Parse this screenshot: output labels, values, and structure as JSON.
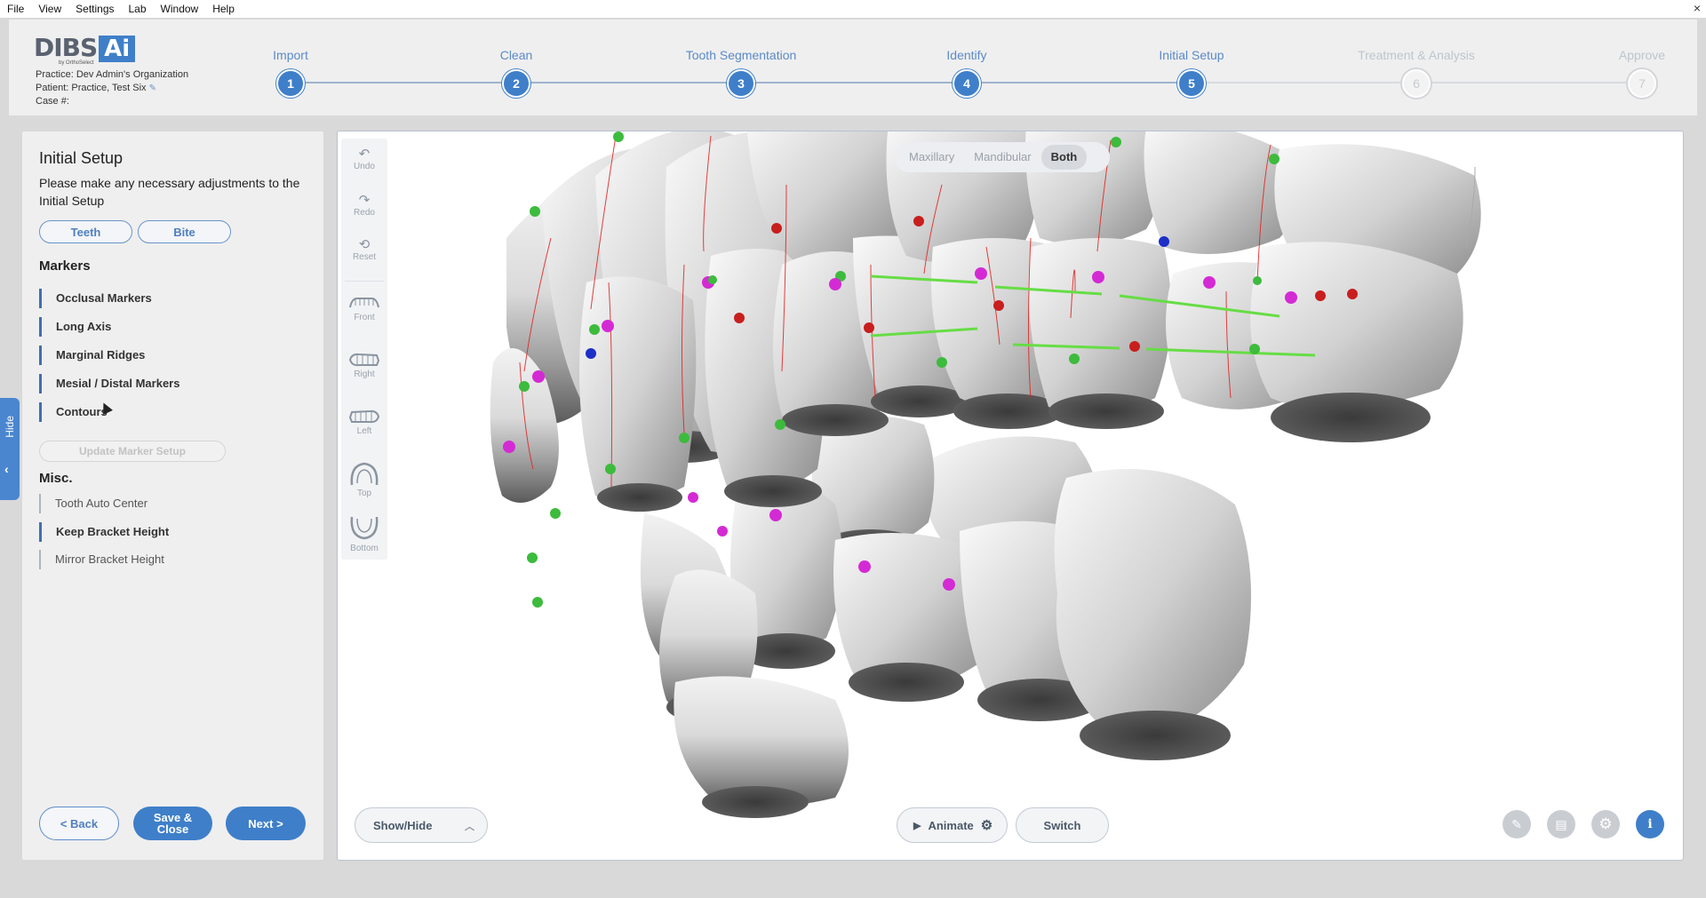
{
  "menu": [
    "File",
    "View",
    "Settings",
    "Lab",
    "Window",
    "Help"
  ],
  "window_close": "×",
  "logo": {
    "main": "DIBS",
    "accent": "Ai",
    "sub": "by OrthoSelect"
  },
  "practice_info": {
    "practice": "Practice: Dev Admin's Organization",
    "patient": "Patient: Practice, Test Six",
    "case": "Case #:"
  },
  "steps": [
    {
      "label": "Import",
      "number": "1",
      "state": "done"
    },
    {
      "label": "Clean",
      "number": "2",
      "state": "done"
    },
    {
      "label": "Tooth Segmentation",
      "number": "3",
      "state": "done"
    },
    {
      "label": "Identify",
      "number": "4",
      "state": "done"
    },
    {
      "label": "Initial Setup",
      "number": "5",
      "state": "current"
    },
    {
      "label": "Treatment & Analysis",
      "number": "6",
      "state": "inactive"
    },
    {
      "label": "Approve",
      "number": "7",
      "state": "inactive"
    }
  ],
  "hide_tab": {
    "label": "Hide",
    "chevron": "‹"
  },
  "left_panel": {
    "title": "Initial Setup",
    "description": "Please make any necessary adjustments to the Initial Setup",
    "toggle": {
      "teeth": "Teeth",
      "bite": "Bite"
    },
    "markers_heading": "Markers",
    "markers": [
      "Occlusal Markers",
      "Long Axis",
      "Marginal Ridges",
      "Mesial / Distal Markers",
      "Contours"
    ],
    "update_button": "Update Marker Setup",
    "misc_heading": "Misc.",
    "misc": [
      "Tooth Auto Center",
      "Keep Bracket Height",
      "Mirror Bracket Height"
    ],
    "back_button": "<  Back",
    "save_close_button_line1": "Save &",
    "save_close_button_line2": "Close",
    "next_button": "Next  >"
  },
  "viewer": {
    "tools": [
      {
        "label": "Undo",
        "icon": "undo-icon"
      },
      {
        "label": "Redo",
        "icon": "redo-icon"
      },
      {
        "label": "Reset",
        "icon": "reset-icon"
      },
      {
        "label": "Front",
        "icon": "front-view-icon"
      },
      {
        "label": "Right",
        "icon": "right-view-icon"
      },
      {
        "label": "Left",
        "icon": "left-view-icon"
      },
      {
        "label": "Top",
        "icon": "top-view-icon"
      },
      {
        "label": "Bottom",
        "icon": "bottom-view-icon"
      }
    ],
    "arch_toggle": {
      "maxillary": "Maxillary",
      "mandibular": "Mandibular",
      "both": "Both",
      "selected": "Both"
    },
    "show_hide": "Show/Hide",
    "animate": "Animate",
    "switch": "Switch"
  },
  "colors": {
    "accent": "#3f7fc9",
    "marker_green": "#3dbb3d",
    "marker_magenta": "#d42ad4",
    "marker_red": "#c81e1e",
    "marker_blue": "#1e2fc8",
    "axis_red": "#e02020",
    "occlusal_line": "#66dd44"
  }
}
